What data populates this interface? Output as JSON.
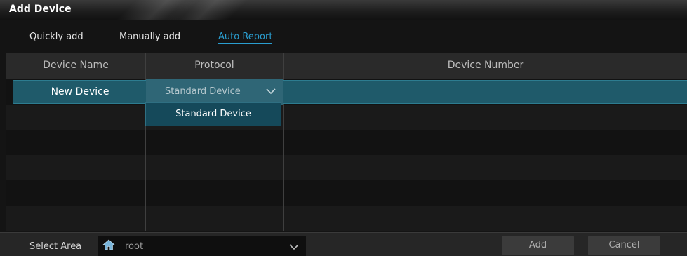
{
  "window": {
    "title": "Add Device"
  },
  "tabs": [
    {
      "label": "Quickly add"
    },
    {
      "label": "Manually add"
    },
    {
      "label": "Auto Report",
      "active": true
    }
  ],
  "table": {
    "columns": [
      "Device Name",
      "Protocol",
      "Device Number"
    ],
    "rows": [
      {
        "device_name": "New Device",
        "protocol": "Standard Device",
        "device_number": ""
      }
    ]
  },
  "protocol_dropdown": {
    "options": [
      "Standard Device"
    ]
  },
  "bottom": {
    "select_area_label": "Select Area",
    "area_value": "root",
    "add_label": "Add",
    "cancel_label": "Cancel"
  },
  "colors": {
    "accent": "#2a9ed0",
    "selected_row": "#1f5a6a",
    "dropdown_bg": "#15495a"
  },
  "icons": {
    "area": "home-icon",
    "dropdown": "chevron-down-icon"
  }
}
